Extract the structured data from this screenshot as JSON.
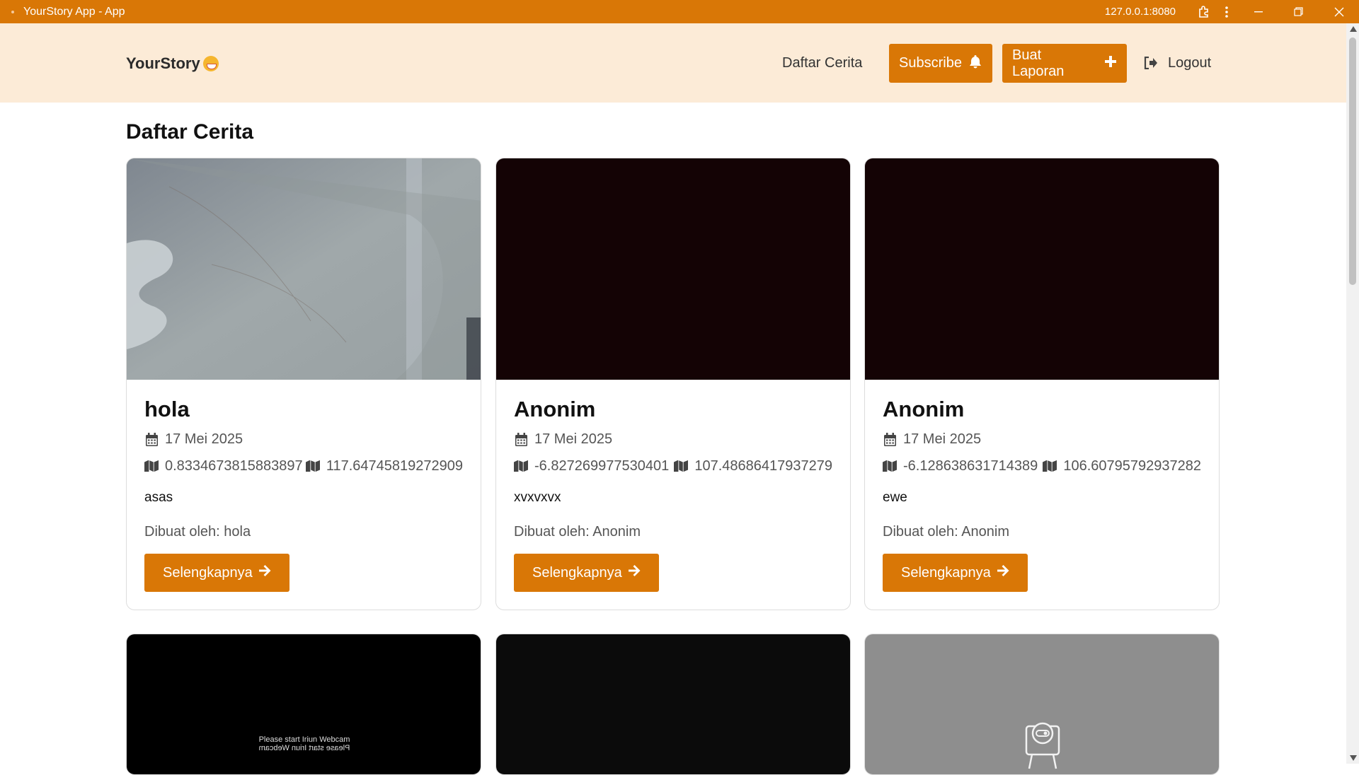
{
  "window": {
    "title": "YourStory App - App",
    "url": "127.0.0.1:8080"
  },
  "navbar": {
    "brand": "YourStory",
    "links": {
      "daftar": "Daftar Cerita",
      "subscribe": "Subscribe",
      "buat": "Buat Laporan",
      "logout": "Logout"
    }
  },
  "main": {
    "title": "Daftar Cerita",
    "cards": [
      {
        "name": "hola",
        "date": "17 Mei 2025",
        "lat": "0.8334673815883897",
        "lon": "117.64745819272909",
        "desc": "asas",
        "author": "Dibuat oleh: hola",
        "button": "Selengkapnya"
      },
      {
        "name": "Anonim",
        "date": "17 Mei 2025",
        "lat": "-6.827269977530401",
        "lon": "107.48686417937279",
        "desc": "xvxvxvx",
        "author": "Dibuat oleh: Anonim",
        "button": "Selengkapnya"
      },
      {
        "name": "Anonim",
        "date": "17 Mei 2025",
        "lat": "-6.128638631714389",
        "lon": "106.60795792937282",
        "desc": "ewe",
        "author": "Dibuat oleh: Anonim",
        "button": "Selengkapnya"
      }
    ],
    "row2_cards": [
      {
        "overlay_text_1": "Please start Iriun Webcam",
        "overlay_text_2": "Please start Iriun Webcam"
      },
      {},
      {}
    ]
  },
  "colors": {
    "accent": "#d97706",
    "navbar_bg": "#fcebd7"
  },
  "icons": [
    "calendar-icon",
    "map-icon",
    "bell-icon",
    "plus-icon",
    "logout-icon",
    "arrow-right-icon",
    "extensions-icon",
    "menu-icon"
  ]
}
